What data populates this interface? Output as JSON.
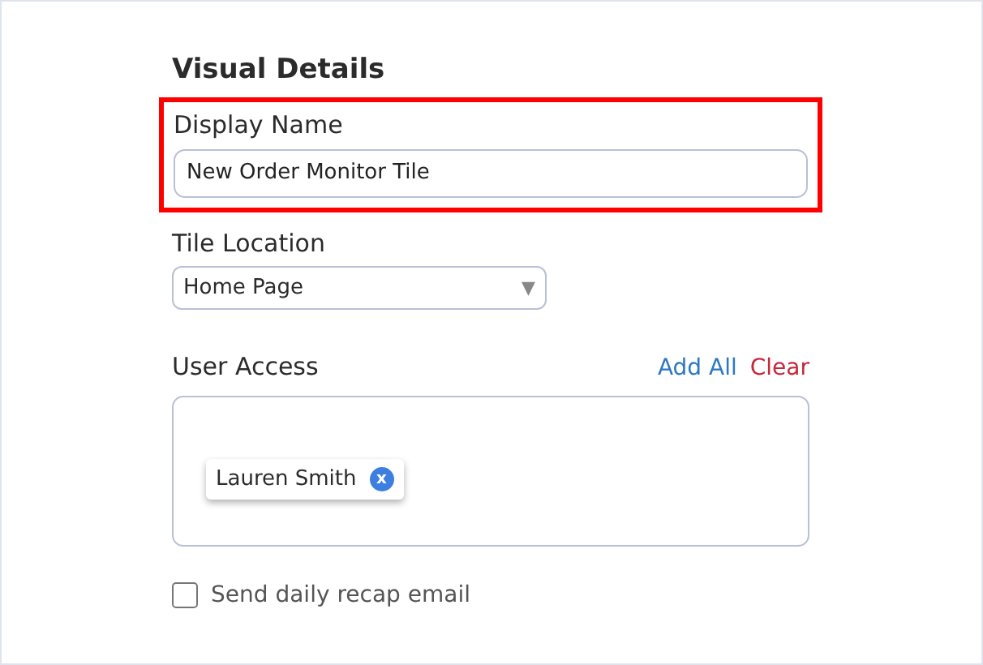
{
  "heading": "Visual Details",
  "display_name": {
    "label": "Display Name",
    "value": "New Order Monitor Tile",
    "highlighted": true
  },
  "tile_location": {
    "label": "Tile Location",
    "value": "Home Page",
    "caret": "▼"
  },
  "user_access": {
    "label": "User Access",
    "actions": [
      {
        "label": "Add All",
        "kind": "add"
      },
      {
        "label": "Clear",
        "kind": "clear"
      }
    ],
    "users": [
      {
        "name": "Lauren Smith",
        "remove": "x"
      }
    ]
  },
  "recap": {
    "label": "Send daily recap email",
    "checked": false
  }
}
